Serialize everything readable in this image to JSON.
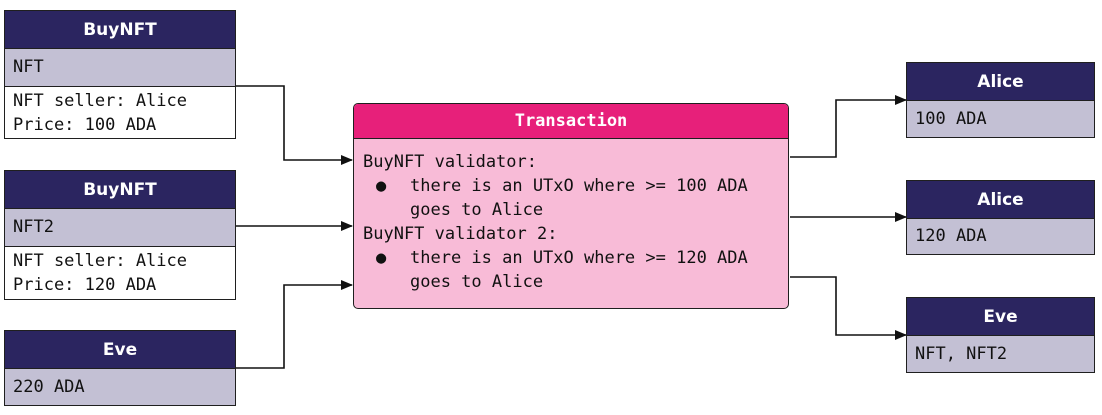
{
  "inputs": [
    {
      "title": "BuyNFT",
      "value": "NFT",
      "datum": [
        "NFT seller: Alice",
        "Price: 100 ADA"
      ]
    },
    {
      "title": "BuyNFT",
      "value": "NFT2",
      "datum": [
        "NFT seller: Alice",
        "Price: 120 ADA"
      ]
    },
    {
      "title": "Eve",
      "value": "220 ADA"
    }
  ],
  "transaction": {
    "title": "Transaction",
    "validator1": "BuyNFT validator:",
    "validator1_bullet": "●",
    "validator1_line1": "there is an UTxO where >= 100 ADA",
    "validator1_line2": "goes to Alice",
    "validator2": "BuyNFT validator 2:",
    "validator2_bullet": "●",
    "validator2_line1": "there is an UTxO where >= 120 ADA",
    "validator2_line2": "goes to Alice"
  },
  "outputs": [
    {
      "title": "Alice",
      "value": "100 ADA"
    },
    {
      "title": "Alice",
      "value": "120 ADA"
    },
    {
      "title": "Eve",
      "value": "NFT, NFT2"
    }
  ],
  "colors": {
    "header": "#2b2560",
    "value_row": "#c3c0d4",
    "transaction_header": "#e7207a",
    "transaction_body": "#f8bbd7"
  }
}
